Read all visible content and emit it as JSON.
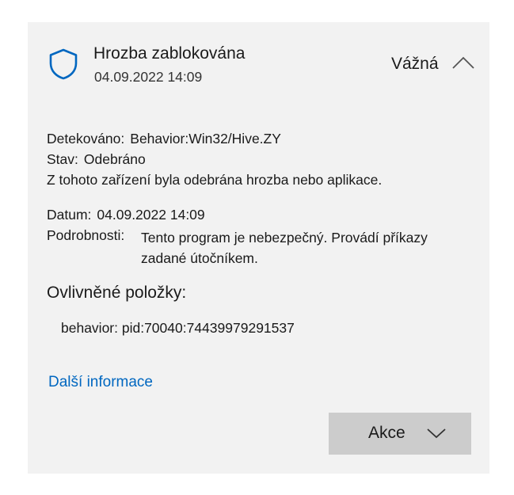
{
  "threat": {
    "title": "Hrozba zablokována",
    "date": "04.09.2022 14:09",
    "severity": "Vážná"
  },
  "details": {
    "detected_label": "Detekováno:",
    "detected_value": "Behavior:Win32/Hive.ZY",
    "status_label": "Stav:",
    "status_value": "Odebráno",
    "status_message": "Z tohoto zařízení byla odebrána hrozba nebo aplikace.",
    "date_label": "Datum:",
    "date_value": "04.09.2022 14:09",
    "details_label": "Podrobnosti:",
    "details_value": "Tento program je nebezpečný. Provádí příkazy zadané útočníkem."
  },
  "affected": {
    "heading": "Ovlivněné položky:",
    "items": [
      "behavior: pid:70040:74439979291537"
    ]
  },
  "more_info_link": "Další informace",
  "action_button": {
    "label": "Akce"
  },
  "icons": {
    "shield": "shield-icon",
    "collapse": "chevron-up-icon",
    "dropdown": "chevron-down-icon"
  },
  "colors": {
    "card_background": "#f2f2f2",
    "accent": "#0067c0",
    "button_background": "#cccccc"
  }
}
